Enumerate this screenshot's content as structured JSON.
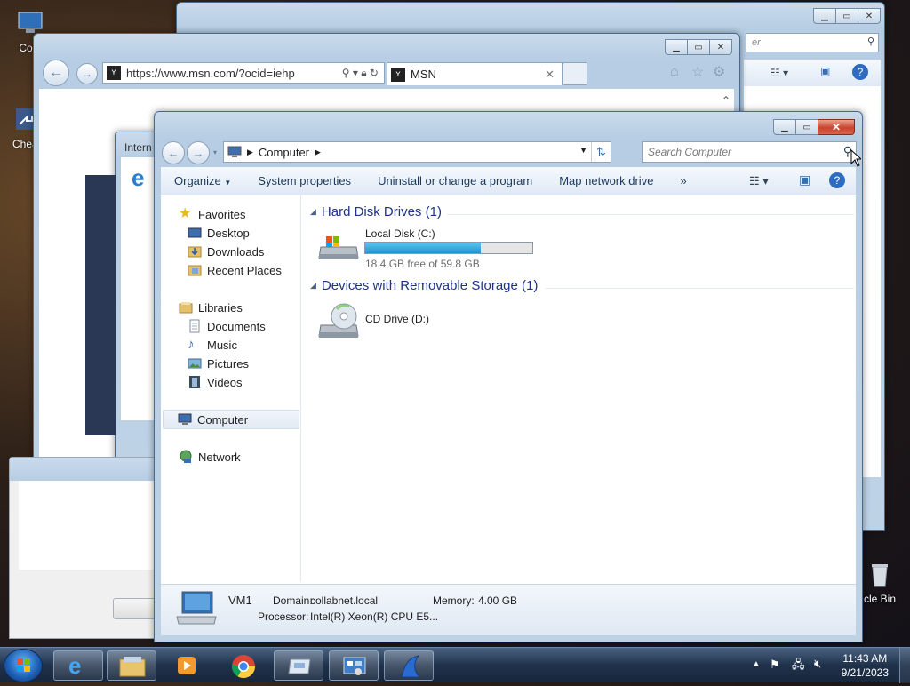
{
  "desktop": {
    "icons": [
      {
        "label": "Com"
      },
      {
        "label": "Cheat"
      },
      {
        "label": "cle Bin"
      }
    ]
  },
  "bg_window": {
    "search_fragment": "er"
  },
  "ie_window": {
    "url": "https://www.msn.com/?ocid=iehp",
    "tab_title": "MSN"
  },
  "small_window": {
    "title_fragment": "Intern"
  },
  "explorer": {
    "breadcrumb": "Computer",
    "search_placeholder": "Search Computer",
    "commands": {
      "organize": "Organize",
      "system_properties": "System properties",
      "uninstall": "Uninstall or change a program",
      "map_drive": "Map network drive",
      "more": "»"
    },
    "nav": {
      "favorites": "Favorites",
      "desktop": "Desktop",
      "downloads": "Downloads",
      "recent_places": "Recent Places",
      "libraries": "Libraries",
      "documents": "Documents",
      "music": "Music",
      "pictures": "Pictures",
      "videos": "Videos",
      "computer": "Computer",
      "network": "Network"
    },
    "groups": {
      "hdd_header": "Hard Disk Drives (1)",
      "removable_header": "Devices with Removable Storage (1)"
    },
    "drives": {
      "local_disk_name": "Local Disk (C:)",
      "local_disk_free": "18.4 GB free of 59.8 GB",
      "local_disk_used_fraction": 0.69,
      "cd_drive_name": "CD Drive (D:)"
    },
    "details": {
      "computer_name": "VM1",
      "domain_label": "Domain:",
      "domain_value": "collabnet.local",
      "memory_label": "Memory:",
      "memory_value": "4.00 GB",
      "processor_label": "Processor:",
      "processor_value": "Intel(R) Xeon(R) CPU E5..."
    }
  },
  "taskbar": {
    "time": "11:43 AM",
    "date": "9/21/2023"
  },
  "colors": {
    "drive_bar": "#26a0da",
    "link_blue": "#1e3287"
  }
}
